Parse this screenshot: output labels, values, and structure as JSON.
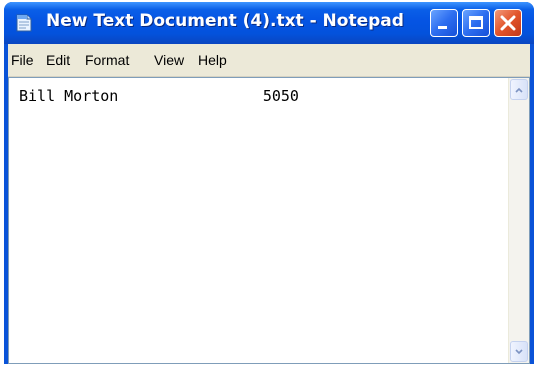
{
  "window": {
    "title": "New Text Document (4).txt - Notepad"
  },
  "menu": {
    "items": [
      "File",
      "Edit",
      "Format",
      "View",
      "Help"
    ]
  },
  "editor": {
    "content": "Bill Morton                5050"
  },
  "icons": {
    "app": "notepad-icon",
    "minimize": "minimize-icon",
    "maximize": "maximize-icon",
    "close": "close-icon",
    "scroll_up": "chevron-up-icon",
    "scroll_down": "chevron-down-icon"
  },
  "colors": {
    "titlebar": "#0554e3",
    "close_button": "#e2542b",
    "menubar": "#ece9d8",
    "editor_background": "#ffffff"
  }
}
